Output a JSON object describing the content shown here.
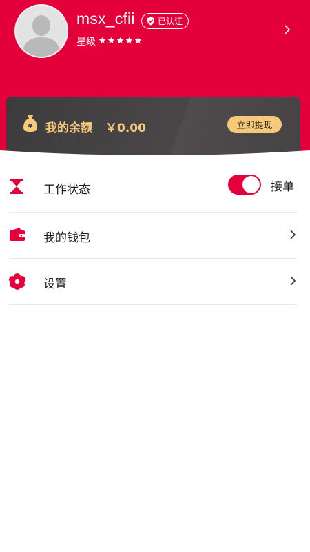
{
  "profile": {
    "username": "msx_cfii",
    "verified_label": "已认证",
    "star_label": "星级",
    "star_rating": 5
  },
  "balance": {
    "label": "我的余额",
    "amount": "￥0.00",
    "withdraw_label": "立即提现"
  },
  "menu": {
    "work_status": {
      "label": "工作状态",
      "toggle_on": true,
      "toggle_text": "接单"
    },
    "wallet": {
      "label": "我的钱包"
    },
    "settings": {
      "label": "设置"
    }
  },
  "colors": {
    "brand": "#e4003a",
    "gold": "#f6c97a",
    "card": "#3f3c3d"
  }
}
